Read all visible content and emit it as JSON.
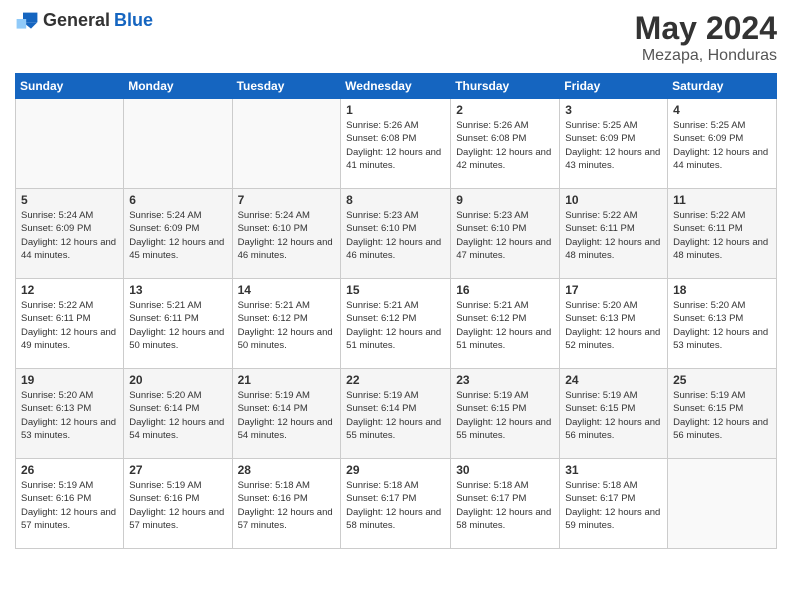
{
  "logo": {
    "general": "General",
    "blue": "Blue"
  },
  "header": {
    "month": "May 2024",
    "location": "Mezapa, Honduras"
  },
  "weekdays": [
    "Sunday",
    "Monday",
    "Tuesday",
    "Wednesday",
    "Thursday",
    "Friday",
    "Saturday"
  ],
  "weeks": [
    [
      {
        "day": "",
        "sunrise": "",
        "sunset": "",
        "daylight": ""
      },
      {
        "day": "",
        "sunrise": "",
        "sunset": "",
        "daylight": ""
      },
      {
        "day": "",
        "sunrise": "",
        "sunset": "",
        "daylight": ""
      },
      {
        "day": "1",
        "sunrise": "Sunrise: 5:26 AM",
        "sunset": "Sunset: 6:08 PM",
        "daylight": "Daylight: 12 hours and 41 minutes."
      },
      {
        "day": "2",
        "sunrise": "Sunrise: 5:26 AM",
        "sunset": "Sunset: 6:08 PM",
        "daylight": "Daylight: 12 hours and 42 minutes."
      },
      {
        "day": "3",
        "sunrise": "Sunrise: 5:25 AM",
        "sunset": "Sunset: 6:09 PM",
        "daylight": "Daylight: 12 hours and 43 minutes."
      },
      {
        "day": "4",
        "sunrise": "Sunrise: 5:25 AM",
        "sunset": "Sunset: 6:09 PM",
        "daylight": "Daylight: 12 hours and 44 minutes."
      }
    ],
    [
      {
        "day": "5",
        "sunrise": "Sunrise: 5:24 AM",
        "sunset": "Sunset: 6:09 PM",
        "daylight": "Daylight: 12 hours and 44 minutes."
      },
      {
        "day": "6",
        "sunrise": "Sunrise: 5:24 AM",
        "sunset": "Sunset: 6:09 PM",
        "daylight": "Daylight: 12 hours and 45 minutes."
      },
      {
        "day": "7",
        "sunrise": "Sunrise: 5:24 AM",
        "sunset": "Sunset: 6:10 PM",
        "daylight": "Daylight: 12 hours and 46 minutes."
      },
      {
        "day": "8",
        "sunrise": "Sunrise: 5:23 AM",
        "sunset": "Sunset: 6:10 PM",
        "daylight": "Daylight: 12 hours and 46 minutes."
      },
      {
        "day": "9",
        "sunrise": "Sunrise: 5:23 AM",
        "sunset": "Sunset: 6:10 PM",
        "daylight": "Daylight: 12 hours and 47 minutes."
      },
      {
        "day": "10",
        "sunrise": "Sunrise: 5:22 AM",
        "sunset": "Sunset: 6:11 PM",
        "daylight": "Daylight: 12 hours and 48 minutes."
      },
      {
        "day": "11",
        "sunrise": "Sunrise: 5:22 AM",
        "sunset": "Sunset: 6:11 PM",
        "daylight": "Daylight: 12 hours and 48 minutes."
      }
    ],
    [
      {
        "day": "12",
        "sunrise": "Sunrise: 5:22 AM",
        "sunset": "Sunset: 6:11 PM",
        "daylight": "Daylight: 12 hours and 49 minutes."
      },
      {
        "day": "13",
        "sunrise": "Sunrise: 5:21 AM",
        "sunset": "Sunset: 6:11 PM",
        "daylight": "Daylight: 12 hours and 50 minutes."
      },
      {
        "day": "14",
        "sunrise": "Sunrise: 5:21 AM",
        "sunset": "Sunset: 6:12 PM",
        "daylight": "Daylight: 12 hours and 50 minutes."
      },
      {
        "day": "15",
        "sunrise": "Sunrise: 5:21 AM",
        "sunset": "Sunset: 6:12 PM",
        "daylight": "Daylight: 12 hours and 51 minutes."
      },
      {
        "day": "16",
        "sunrise": "Sunrise: 5:21 AM",
        "sunset": "Sunset: 6:12 PM",
        "daylight": "Daylight: 12 hours and 51 minutes."
      },
      {
        "day": "17",
        "sunrise": "Sunrise: 5:20 AM",
        "sunset": "Sunset: 6:13 PM",
        "daylight": "Daylight: 12 hours and 52 minutes."
      },
      {
        "day": "18",
        "sunrise": "Sunrise: 5:20 AM",
        "sunset": "Sunset: 6:13 PM",
        "daylight": "Daylight: 12 hours and 53 minutes."
      }
    ],
    [
      {
        "day": "19",
        "sunrise": "Sunrise: 5:20 AM",
        "sunset": "Sunset: 6:13 PM",
        "daylight": "Daylight: 12 hours and 53 minutes."
      },
      {
        "day": "20",
        "sunrise": "Sunrise: 5:20 AM",
        "sunset": "Sunset: 6:14 PM",
        "daylight": "Daylight: 12 hours and 54 minutes."
      },
      {
        "day": "21",
        "sunrise": "Sunrise: 5:19 AM",
        "sunset": "Sunset: 6:14 PM",
        "daylight": "Daylight: 12 hours and 54 minutes."
      },
      {
        "day": "22",
        "sunrise": "Sunrise: 5:19 AM",
        "sunset": "Sunset: 6:14 PM",
        "daylight": "Daylight: 12 hours and 55 minutes."
      },
      {
        "day": "23",
        "sunrise": "Sunrise: 5:19 AM",
        "sunset": "Sunset: 6:15 PM",
        "daylight": "Daylight: 12 hours and 55 minutes."
      },
      {
        "day": "24",
        "sunrise": "Sunrise: 5:19 AM",
        "sunset": "Sunset: 6:15 PM",
        "daylight": "Daylight: 12 hours and 56 minutes."
      },
      {
        "day": "25",
        "sunrise": "Sunrise: 5:19 AM",
        "sunset": "Sunset: 6:15 PM",
        "daylight": "Daylight: 12 hours and 56 minutes."
      }
    ],
    [
      {
        "day": "26",
        "sunrise": "Sunrise: 5:19 AM",
        "sunset": "Sunset: 6:16 PM",
        "daylight": "Daylight: 12 hours and 57 minutes."
      },
      {
        "day": "27",
        "sunrise": "Sunrise: 5:19 AM",
        "sunset": "Sunset: 6:16 PM",
        "daylight": "Daylight: 12 hours and 57 minutes."
      },
      {
        "day": "28",
        "sunrise": "Sunrise: 5:18 AM",
        "sunset": "Sunset: 6:16 PM",
        "daylight": "Daylight: 12 hours and 57 minutes."
      },
      {
        "day": "29",
        "sunrise": "Sunrise: 5:18 AM",
        "sunset": "Sunset: 6:17 PM",
        "daylight": "Daylight: 12 hours and 58 minutes."
      },
      {
        "day": "30",
        "sunrise": "Sunrise: 5:18 AM",
        "sunset": "Sunset: 6:17 PM",
        "daylight": "Daylight: 12 hours and 58 minutes."
      },
      {
        "day": "31",
        "sunrise": "Sunrise: 5:18 AM",
        "sunset": "Sunset: 6:17 PM",
        "daylight": "Daylight: 12 hours and 59 minutes."
      },
      {
        "day": "",
        "sunrise": "",
        "sunset": "",
        "daylight": ""
      }
    ]
  ]
}
